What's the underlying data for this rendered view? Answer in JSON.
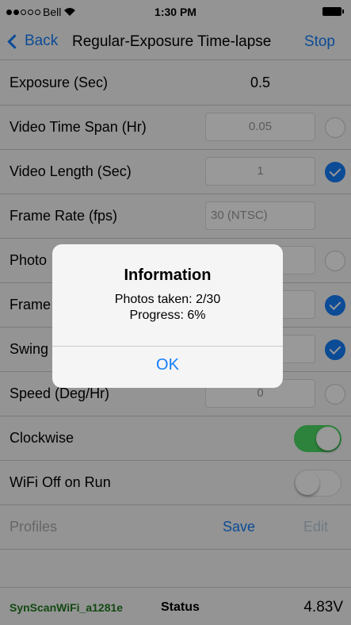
{
  "status_bar": {
    "carrier": "Bell",
    "time": "1:30 PM"
  },
  "nav": {
    "back": "Back",
    "title": "Regular-Exposure Time-lapse",
    "action": "Stop"
  },
  "rows": {
    "exposure": {
      "label": "Exposure (Sec)",
      "value": "0.5"
    },
    "time_span": {
      "label": "Video Time Span (Hr)",
      "value": "0.05",
      "selected": false
    },
    "video_length": {
      "label": "Video Length (Sec)",
      "value": "1",
      "selected": true
    },
    "frame_rate": {
      "label": "Frame Rate (fps)",
      "value": "30 (NTSC)"
    },
    "photos": {
      "label": "Photo",
      "selected": false
    },
    "frame": {
      "label": "Frame",
      "selected": true
    },
    "swing": {
      "label": "Swing",
      "selected": true
    },
    "speed": {
      "label": "Speed (Deg/Hr)",
      "value": "0",
      "selected": false
    },
    "clockwise": {
      "label": "Clockwise",
      "on": true
    },
    "wifi_off": {
      "label": "WiFi Off on Run",
      "on": false
    }
  },
  "profiles": {
    "label": "Profiles",
    "save": "Save",
    "edit": "Edit"
  },
  "bottom": {
    "wifi_name": "SynScanWiFi_a1281e",
    "status": "Status",
    "voltage": "4.83V"
  },
  "alert": {
    "title": "Information",
    "line1": "Photos taken: 2/30",
    "line2": "Progress: 6%",
    "button": "OK"
  },
  "colors": {
    "accent": "#147efb",
    "switch_on": "#4cd964",
    "wifi_name": "#1f7a1f"
  }
}
